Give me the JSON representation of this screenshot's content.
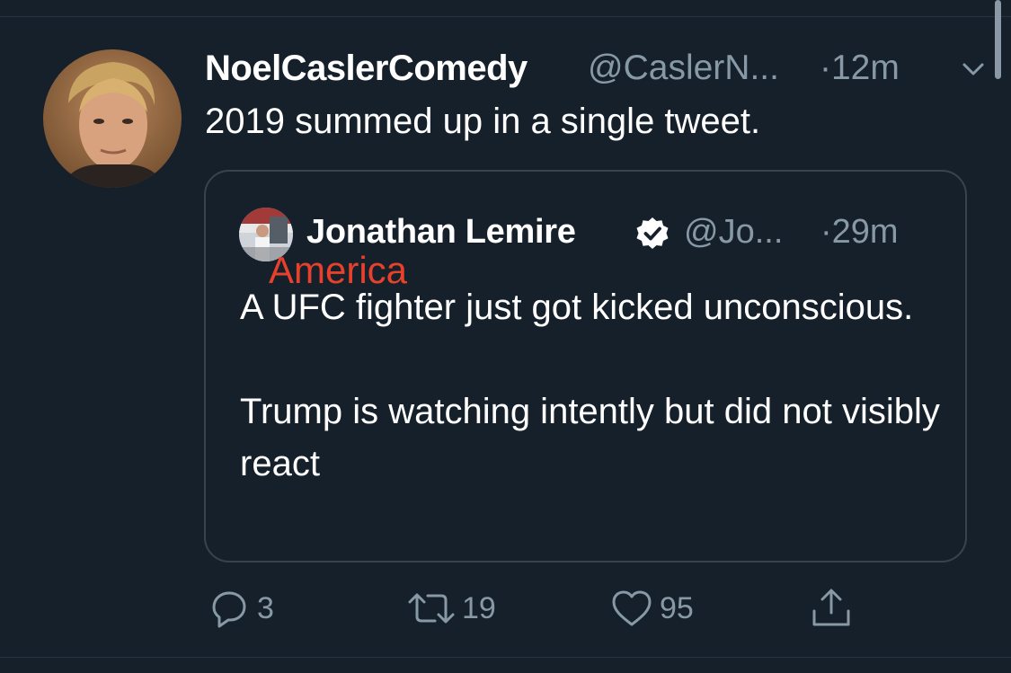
{
  "tweet": {
    "display_name": "NoelCaslerComedy",
    "handle": "@CaslerN...",
    "time": "·12m",
    "text": "2019 summed up in a single tweet."
  },
  "quoted_tweet": {
    "display_name": "Jonathan Lemire",
    "handle": "@Jo...",
    "time": "·29m",
    "verified": true,
    "paragraphs": [
      "A UFC fighter just got kicked unconscious.",
      "Trump is watching intently but did not visibly react"
    ],
    "overlay_label": "America"
  },
  "actions": {
    "reply_count": "3",
    "retweet_count": "19",
    "like_count": "95"
  },
  "icons": {
    "menu": "chevron-down-icon",
    "verified": "verified-badge-icon",
    "reply": "reply-icon",
    "retweet": "retweet-icon",
    "like": "heart-icon",
    "share": "share-icon"
  },
  "colors": {
    "background": "#15202b",
    "secondary_text": "#8899a6",
    "border": "#38444d",
    "overlay_label": "#e8412b"
  }
}
